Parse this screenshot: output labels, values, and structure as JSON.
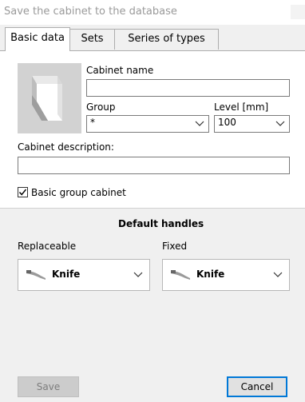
{
  "window": {
    "title": "Save the cabinet to the database"
  },
  "tabs": [
    {
      "label": "Basic data",
      "active": true
    },
    {
      "label": "Sets",
      "active": false
    },
    {
      "label": "Series of types",
      "active": false
    }
  ],
  "form": {
    "cabinet_name_label": "Cabinet name",
    "cabinet_name_value": "",
    "group_label": "Group",
    "group_value": "*",
    "level_label": "Level [mm]",
    "level_value": "100",
    "description_label": "Cabinet description:",
    "description_value": "",
    "basic_group_label": "Basic group cabinet",
    "basic_group_checked": true
  },
  "handles": {
    "title": "Default handles",
    "replaceable_label": "Replaceable",
    "replaceable_value": "Knife",
    "fixed_label": "Fixed",
    "fixed_value": "Knife"
  },
  "buttons": {
    "save": "Save",
    "cancel": "Cancel"
  },
  "colors": {
    "accent": "#0078d7",
    "window_bg": "#f0f0f0"
  },
  "icons": [
    "close-icon",
    "cabinet-preview-image",
    "chevron-down-icon",
    "checkmark-icon",
    "knife-handle-icon"
  ]
}
